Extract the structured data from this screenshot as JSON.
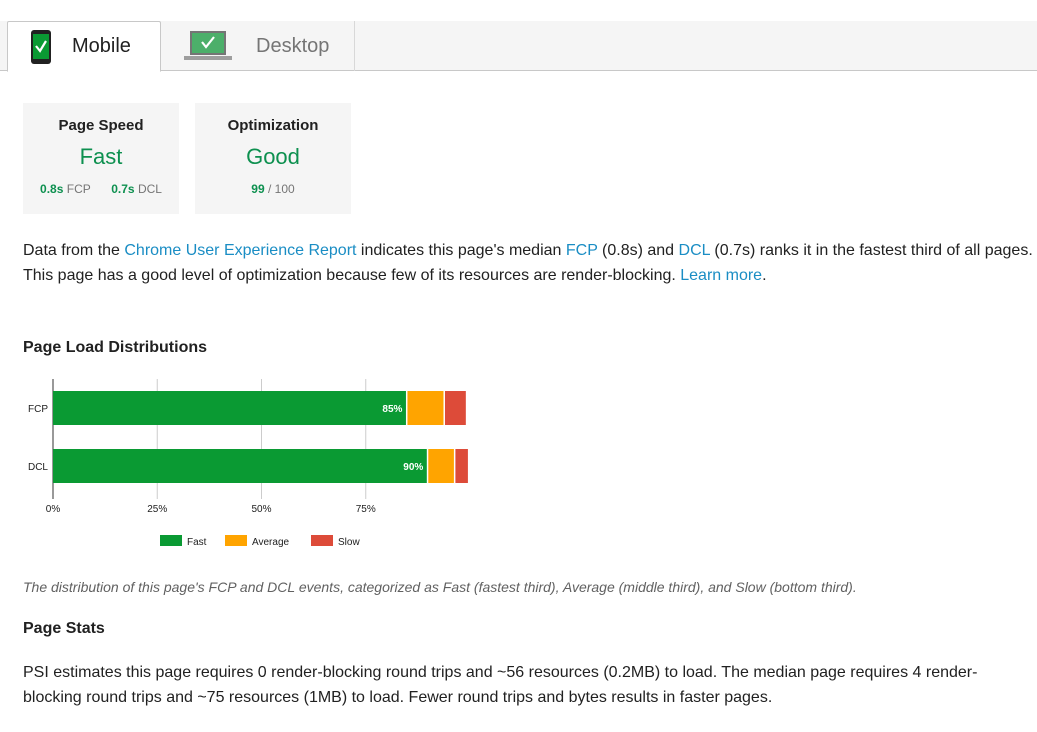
{
  "tabs": {
    "mobile": {
      "label": "Mobile",
      "icon": "mobile-phone-check-icon"
    },
    "desktop": {
      "label": "Desktop",
      "icon": "laptop-check-icon"
    }
  },
  "cards": {
    "speed": {
      "title": "Page Speed",
      "value": "Fast",
      "fcp_value": "0.8s",
      "fcp_label": "FCP",
      "dcl_value": "0.7s",
      "dcl_label": "DCL"
    },
    "optimization": {
      "title": "Optimization",
      "value": "Good",
      "score": "99",
      "score_max": "/ 100"
    }
  },
  "description": {
    "part1": "Data from the ",
    "report_link": "Chrome User Experience Report",
    "part2": " indicates this page's median ",
    "fcp_link": "FCP",
    "part3": " (0.8s) and ",
    "dcl_link": "DCL",
    "part4": " (0.7s) ranks it in the fastest third of all pages. This page has a good level of optimization because few of its resources are render-blocking. ",
    "learn_more": "Learn more",
    "part5": "."
  },
  "distributions": {
    "heading": "Page Load Distributions",
    "caption": "The distribution of this page's FCP and DCL events, categorized as Fast (fastest third), Average (middle third), and Slow (bottom third)."
  },
  "stats": {
    "heading": "Page Stats",
    "text": "PSI estimates this page requires 0 render-blocking round trips and ~56 resources (0.2MB) to load. The median page requires 4 render-blocking round trips and ~75 resources (1MB) to load. Fewer round trips and bytes results in faster pages."
  },
  "colors": {
    "fast": "#0a9a33",
    "average": "#ffa400",
    "slow": "#dd4b39",
    "link": "#1a8dc4",
    "good_green": "#0d904f"
  },
  "chart_data": {
    "type": "bar",
    "orientation": "horizontal",
    "stacked": true,
    "categories": [
      "FCP",
      "DCL"
    ],
    "series": [
      {
        "name": "Fast",
        "values": [
          85,
          90
        ]
      },
      {
        "name": "Average",
        "values": [
          9,
          6.5
        ]
      },
      {
        "name": "Slow",
        "values": [
          5,
          3
        ]
      }
    ],
    "data_labels": [
      "85%",
      "90%"
    ],
    "x_ticks": [
      "0%",
      "25%",
      "50%",
      "75%"
    ],
    "xlim": [
      0,
      100
    ],
    "grid": true,
    "legend": "bottom"
  }
}
